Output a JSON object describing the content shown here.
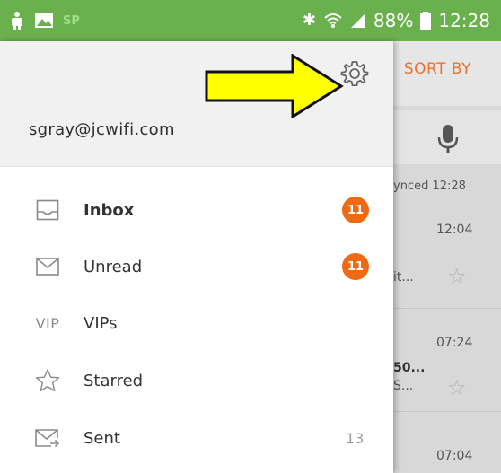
{
  "status_bar": {
    "left_faint": "SP",
    "battery_percent": "88%",
    "time": "12:28"
  },
  "drawer": {
    "account_email": "sgray@jcwifi.com",
    "folders": [
      {
        "label": "Inbox",
        "badge": "11",
        "icon": "inbox-tray-icon"
      },
      {
        "label": "Unread",
        "badge": "11",
        "icon": "envelope-icon"
      },
      {
        "label": "VIPs",
        "icon_text": "VIP",
        "icon": "vip-icon"
      },
      {
        "label": "Starred",
        "icon": "star-icon"
      },
      {
        "label": "Sent",
        "count": "13",
        "icon": "sent-envelope-icon"
      }
    ]
  },
  "background_list": {
    "sort_label": "SORT BY",
    "synced_text": "ynced 12:28",
    "items": [
      {
        "time": "12:04",
        "snippet": "it..."
      },
      {
        "time": "07:24",
        "snippet_line1": "50...",
        "snippet_line2": "S..."
      },
      {
        "time": "07:04"
      }
    ]
  },
  "colors": {
    "status_bar": "#6ab04c",
    "accent_orange": "#f06a12",
    "annotation_arrow": "#ffff00"
  }
}
